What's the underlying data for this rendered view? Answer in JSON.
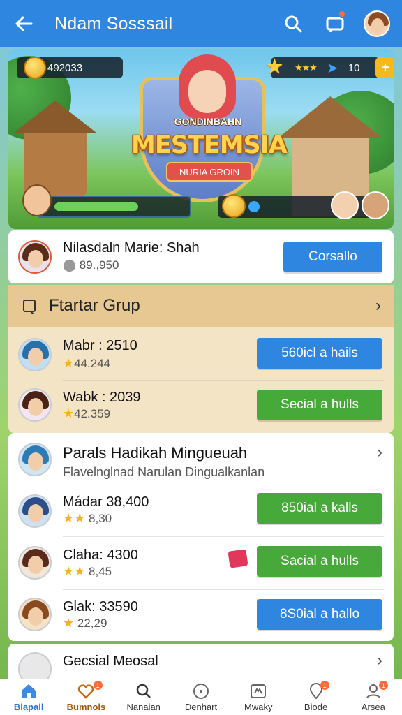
{
  "appbar": {
    "title": "Ndam Sosssail",
    "icons": [
      "back-arrow-icon",
      "search-icon",
      "notification-icon",
      "profile-avatar"
    ]
  },
  "hero": {
    "coins": "492033",
    "stars_count": "10",
    "game_top_text": "GONDINBAHN",
    "game_title": "MESTEMSIA",
    "game_subtitle": "NURIA GROIN"
  },
  "user_card": {
    "name": "Nilasdaln Marie: Shah",
    "score": "89.,950",
    "button": "Corsallo"
  },
  "group": {
    "title": "Ftartar Grup",
    "members": [
      {
        "name": "Mabr : 2510",
        "score": "44.244",
        "button": "560icl a hails",
        "button_color": "blue"
      },
      {
        "name": "Wabk : 2039",
        "score": "42.359",
        "button": "Secial a hulls",
        "button_color": "green"
      }
    ]
  },
  "section": {
    "title": "Parals Hadikah Mingueuah",
    "subtitle": "Flavelnglnad Narulan Dingualkanlan",
    "members": [
      {
        "name": "Mádar 38,400",
        "score": "8,30",
        "button": "850ial a kalls",
        "button_color": "green"
      },
      {
        "name": "Claha: 4300",
        "score": "8,45",
        "button": "Sacial a hulls",
        "button_color": "green"
      },
      {
        "name": "Glak: 33590",
        "score": "22,29",
        "button": "8S0ial a hallo",
        "button_color": "blue"
      }
    ]
  },
  "bottom_card": {
    "title": "Gecsial Meosal"
  },
  "bottom_nav": [
    {
      "label": "Blapail",
      "icon": "home-icon",
      "badge": ""
    },
    {
      "label": "Bumnois",
      "icon": "heart-hands-icon",
      "badge": "1"
    },
    {
      "label": "Nanaian",
      "icon": "search-icon",
      "badge": ""
    },
    {
      "label": "Denhart",
      "icon": "compass-icon",
      "badge": ""
    },
    {
      "label": "Mwaky",
      "icon": "cat-icon",
      "badge": ""
    },
    {
      "label": "Biode",
      "icon": "map-pin-icon",
      "badge": "1"
    },
    {
      "label": "Arsea",
      "icon": "person-icon",
      "badge": "1"
    }
  ],
  "colors": {
    "primary": "#2f86e0",
    "green": "#47a93a",
    "group_bg": "#f4e4c6",
    "group_header": "#e8c892"
  }
}
